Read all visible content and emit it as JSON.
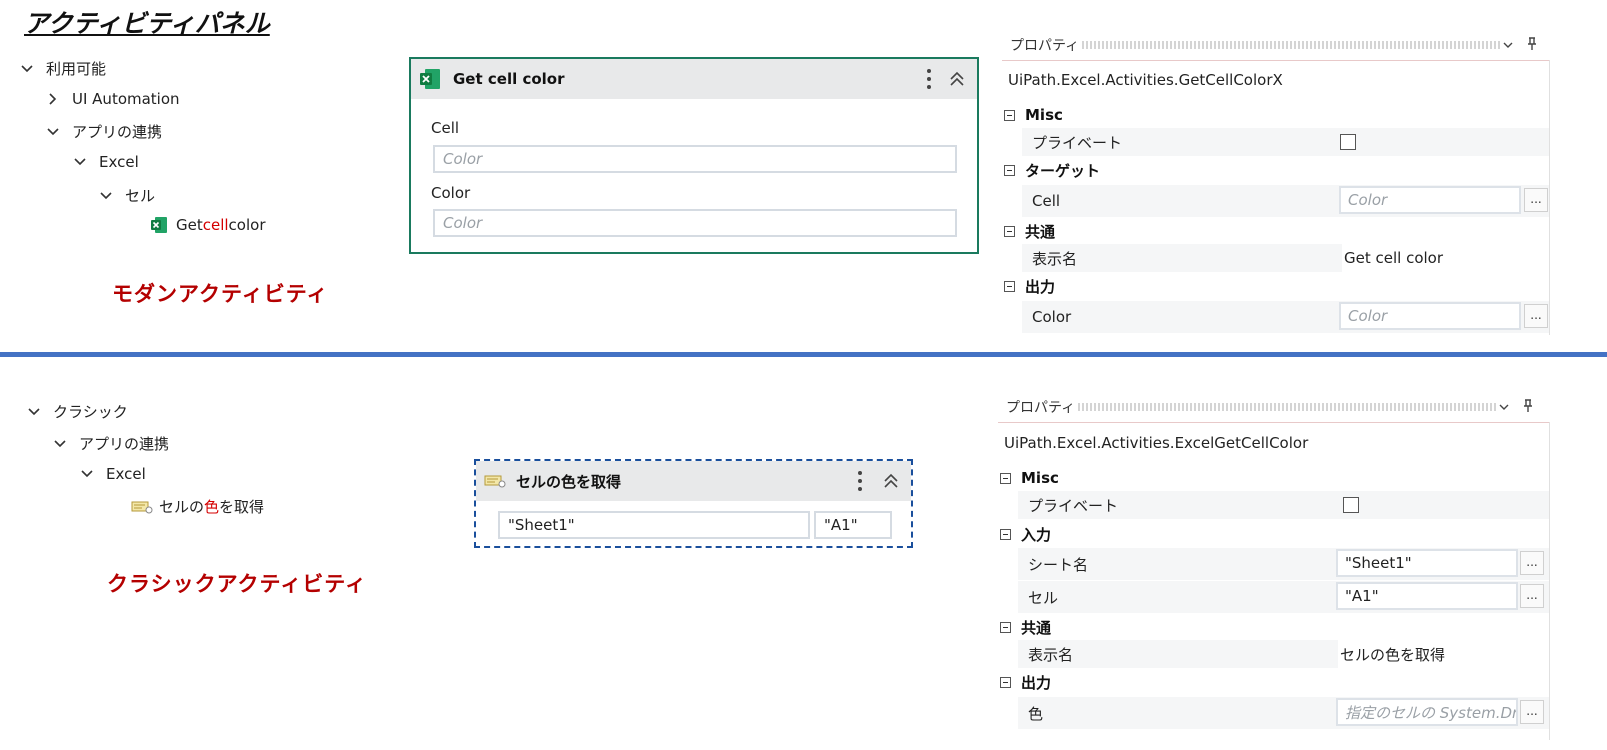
{
  "page_title": "アクティビティパネル",
  "modern": {
    "tree": [
      {
        "label": "利用可能"
      },
      {
        "label": "UI Automation"
      },
      {
        "label": "アプリの連携"
      },
      {
        "label": "Excel"
      },
      {
        "label": "セル"
      }
    ],
    "leaf": {
      "pre": "Get ",
      "hl": "cell",
      "post": " color"
    },
    "caption": "モダンアクティビティ",
    "card": {
      "title": "Get cell color",
      "cell_label": "Cell",
      "cell_placeholder": "Color",
      "color_label": "Color",
      "color_placeholder": "Color"
    },
    "props": {
      "tab": "プロパティ",
      "type": "UiPath.Excel.Activities.GetCellColorX",
      "cat_misc": "Misc",
      "private_label": "プライベート",
      "cat_target": "ターゲット",
      "cell_label": "Cell",
      "cell_placeholder": "Color",
      "cat_common": "共通",
      "display_label": "表示名",
      "display_value": "Get cell color",
      "cat_output": "出力",
      "color_label": "Color",
      "color_placeholder": "Color",
      "dots": "..."
    }
  },
  "classic": {
    "tree": [
      {
        "label": "クラシック"
      },
      {
        "label": "アプリの連携"
      },
      {
        "label": "Excel"
      }
    ],
    "leaf": {
      "pre": "セルの",
      "hl": "色",
      "post": "を取得"
    },
    "caption": "クラシックアクティビティ",
    "card": {
      "title": "セルの色を取得",
      "sheet_value": "\"Sheet1\"",
      "cell_value": "\"A1\""
    },
    "props": {
      "tab": "プロパティ",
      "type": "UiPath.Excel.Activities.ExcelGetCellColor",
      "cat_misc": "Misc",
      "private_label": "プライベート",
      "cat_input": "入力",
      "sheet_label": "シート名",
      "sheet_value": "\"Sheet1\"",
      "cell_label": "セル",
      "cell_value": "\"A1\"",
      "cat_common": "共通",
      "display_label": "表示名",
      "display_value": "セルの色を取得",
      "cat_output": "出力",
      "color_label": "色",
      "color_placeholder": "指定のセルの System.Dra",
      "dots": "..."
    }
  },
  "colors": {
    "divider": "#4472c4",
    "caption_red": "#b40000",
    "highlight_red": "#d40000",
    "modern_border": "#1a7a5e",
    "classic_border": "#1a4f9c",
    "excel_green": "#1d6f42"
  }
}
